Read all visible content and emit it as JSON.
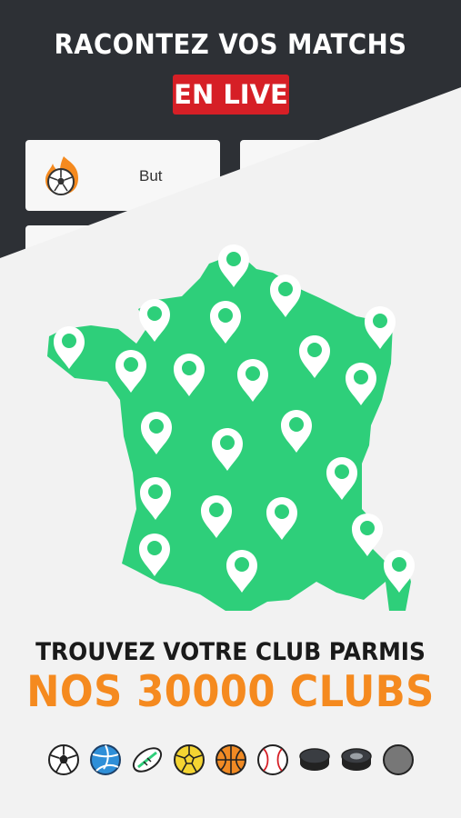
{
  "header": {
    "headline": "RACONTEZ VOS MATCHS",
    "badge": "EN LIVE"
  },
  "cards": [
    {
      "label": "But",
      "icon": "soccer-ball-fire-icon"
    },
    {
      "label": "",
      "icon": "whistle-icon"
    },
    {
      "label": "",
      "icon": ""
    }
  ],
  "main": {
    "line1": "TROUVEZ VOTRE CLUB PARMIS",
    "line2": "NOS 30000 CLUBS"
  },
  "colors": {
    "dark": "#2d3035",
    "red": "#d61f26",
    "green": "#2ecf7a",
    "orange": "#f58a1f"
  },
  "sports": [
    "soccer-ball-icon",
    "volleyball-icon",
    "rugby-ball-icon",
    "handball-icon",
    "basketball-icon",
    "baseball-icon",
    "hockey-puck-icon",
    "roller-hockey-puck-icon",
    "petanque-ball-icon"
  ]
}
